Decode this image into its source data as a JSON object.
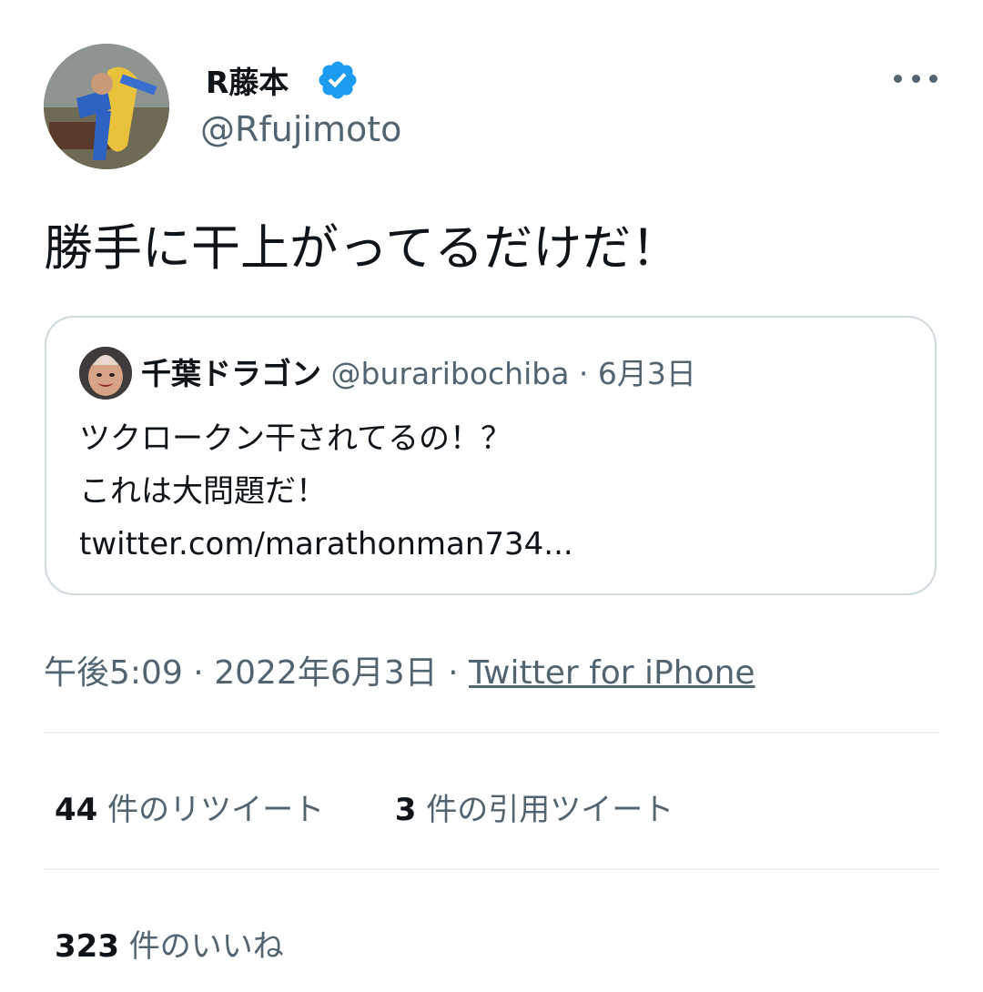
{
  "author": {
    "display_name": "R藤本",
    "handle": "@Rfujimoto",
    "verified": true
  },
  "tweet": {
    "text": "勝手に干上がってるだけだ！"
  },
  "quoted_tweet": {
    "display_name": "千葉ドラゴン",
    "handle": "@buraribochiba",
    "separator": "·",
    "date": "6月3日",
    "lines": [
      "ツクロークン干されてるの！？",
      "これは大問題だ！",
      "twitter.com/marathonman734..."
    ]
  },
  "meta": {
    "time": "午後5:09",
    "separator": "·",
    "date": "2022年6月3日",
    "source": "Twitter for iPhone"
  },
  "stats": {
    "retweets_count": "44",
    "retweets_label": "件のリツイート",
    "quotes_count": "3",
    "quotes_label": "件の引用ツイート",
    "likes_count": "323",
    "likes_label": "件のいいね"
  },
  "icons": {
    "verified": "verified-badge-icon",
    "more": "more-options-icon"
  },
  "colors": {
    "verified": "#1d9bf0",
    "text_primary": "#0f1419",
    "text_secondary": "#536471",
    "border": "#cfd9de",
    "divider": "#eff3f4"
  }
}
